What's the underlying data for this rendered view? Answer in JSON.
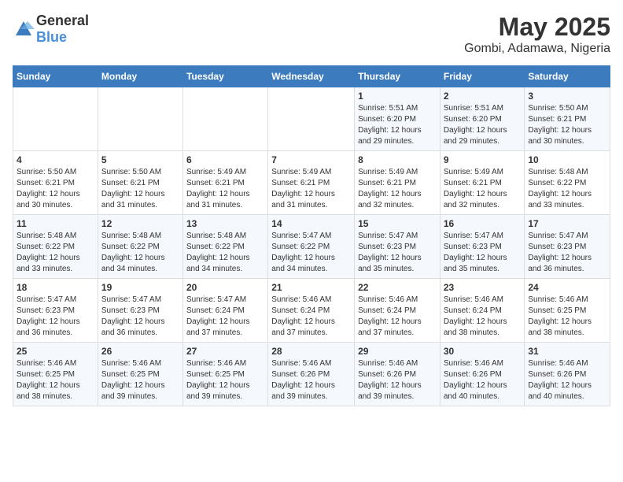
{
  "header": {
    "logo_general": "General",
    "logo_blue": "Blue",
    "title": "May 2025",
    "subtitle": "Gombi, Adamawa, Nigeria"
  },
  "weekdays": [
    "Sunday",
    "Monday",
    "Tuesday",
    "Wednesday",
    "Thursday",
    "Friday",
    "Saturday"
  ],
  "weeks": [
    [
      {
        "day": "",
        "detail": ""
      },
      {
        "day": "",
        "detail": ""
      },
      {
        "day": "",
        "detail": ""
      },
      {
        "day": "",
        "detail": ""
      },
      {
        "day": "1",
        "detail": "Sunrise: 5:51 AM\nSunset: 6:20 PM\nDaylight: 12 hours\nand 29 minutes."
      },
      {
        "day": "2",
        "detail": "Sunrise: 5:51 AM\nSunset: 6:20 PM\nDaylight: 12 hours\nand 29 minutes."
      },
      {
        "day": "3",
        "detail": "Sunrise: 5:50 AM\nSunset: 6:21 PM\nDaylight: 12 hours\nand 30 minutes."
      }
    ],
    [
      {
        "day": "4",
        "detail": "Sunrise: 5:50 AM\nSunset: 6:21 PM\nDaylight: 12 hours\nand 30 minutes."
      },
      {
        "day": "5",
        "detail": "Sunrise: 5:50 AM\nSunset: 6:21 PM\nDaylight: 12 hours\nand 31 minutes."
      },
      {
        "day": "6",
        "detail": "Sunrise: 5:49 AM\nSunset: 6:21 PM\nDaylight: 12 hours\nand 31 minutes."
      },
      {
        "day": "7",
        "detail": "Sunrise: 5:49 AM\nSunset: 6:21 PM\nDaylight: 12 hours\nand 31 minutes."
      },
      {
        "day": "8",
        "detail": "Sunrise: 5:49 AM\nSunset: 6:21 PM\nDaylight: 12 hours\nand 32 minutes."
      },
      {
        "day": "9",
        "detail": "Sunrise: 5:49 AM\nSunset: 6:21 PM\nDaylight: 12 hours\nand 32 minutes."
      },
      {
        "day": "10",
        "detail": "Sunrise: 5:48 AM\nSunset: 6:22 PM\nDaylight: 12 hours\nand 33 minutes."
      }
    ],
    [
      {
        "day": "11",
        "detail": "Sunrise: 5:48 AM\nSunset: 6:22 PM\nDaylight: 12 hours\nand 33 minutes."
      },
      {
        "day": "12",
        "detail": "Sunrise: 5:48 AM\nSunset: 6:22 PM\nDaylight: 12 hours\nand 34 minutes."
      },
      {
        "day": "13",
        "detail": "Sunrise: 5:48 AM\nSunset: 6:22 PM\nDaylight: 12 hours\nand 34 minutes."
      },
      {
        "day": "14",
        "detail": "Sunrise: 5:47 AM\nSunset: 6:22 PM\nDaylight: 12 hours\nand 34 minutes."
      },
      {
        "day": "15",
        "detail": "Sunrise: 5:47 AM\nSunset: 6:23 PM\nDaylight: 12 hours\nand 35 minutes."
      },
      {
        "day": "16",
        "detail": "Sunrise: 5:47 AM\nSunset: 6:23 PM\nDaylight: 12 hours\nand 35 minutes."
      },
      {
        "day": "17",
        "detail": "Sunrise: 5:47 AM\nSunset: 6:23 PM\nDaylight: 12 hours\nand 36 minutes."
      }
    ],
    [
      {
        "day": "18",
        "detail": "Sunrise: 5:47 AM\nSunset: 6:23 PM\nDaylight: 12 hours\nand 36 minutes."
      },
      {
        "day": "19",
        "detail": "Sunrise: 5:47 AM\nSunset: 6:23 PM\nDaylight: 12 hours\nand 36 minutes."
      },
      {
        "day": "20",
        "detail": "Sunrise: 5:47 AM\nSunset: 6:24 PM\nDaylight: 12 hours\nand 37 minutes."
      },
      {
        "day": "21",
        "detail": "Sunrise: 5:46 AM\nSunset: 6:24 PM\nDaylight: 12 hours\nand 37 minutes."
      },
      {
        "day": "22",
        "detail": "Sunrise: 5:46 AM\nSunset: 6:24 PM\nDaylight: 12 hours\nand 37 minutes."
      },
      {
        "day": "23",
        "detail": "Sunrise: 5:46 AM\nSunset: 6:24 PM\nDaylight: 12 hours\nand 38 minutes."
      },
      {
        "day": "24",
        "detail": "Sunrise: 5:46 AM\nSunset: 6:25 PM\nDaylight: 12 hours\nand 38 minutes."
      }
    ],
    [
      {
        "day": "25",
        "detail": "Sunrise: 5:46 AM\nSunset: 6:25 PM\nDaylight: 12 hours\nand 38 minutes."
      },
      {
        "day": "26",
        "detail": "Sunrise: 5:46 AM\nSunset: 6:25 PM\nDaylight: 12 hours\nand 39 minutes."
      },
      {
        "day": "27",
        "detail": "Sunrise: 5:46 AM\nSunset: 6:25 PM\nDaylight: 12 hours\nand 39 minutes."
      },
      {
        "day": "28",
        "detail": "Sunrise: 5:46 AM\nSunset: 6:26 PM\nDaylight: 12 hours\nand 39 minutes."
      },
      {
        "day": "29",
        "detail": "Sunrise: 5:46 AM\nSunset: 6:26 PM\nDaylight: 12 hours\nand 39 minutes."
      },
      {
        "day": "30",
        "detail": "Sunrise: 5:46 AM\nSunset: 6:26 PM\nDaylight: 12 hours\nand 40 minutes."
      },
      {
        "day": "31",
        "detail": "Sunrise: 5:46 AM\nSunset: 6:26 PM\nDaylight: 12 hours\nand 40 minutes."
      }
    ]
  ]
}
